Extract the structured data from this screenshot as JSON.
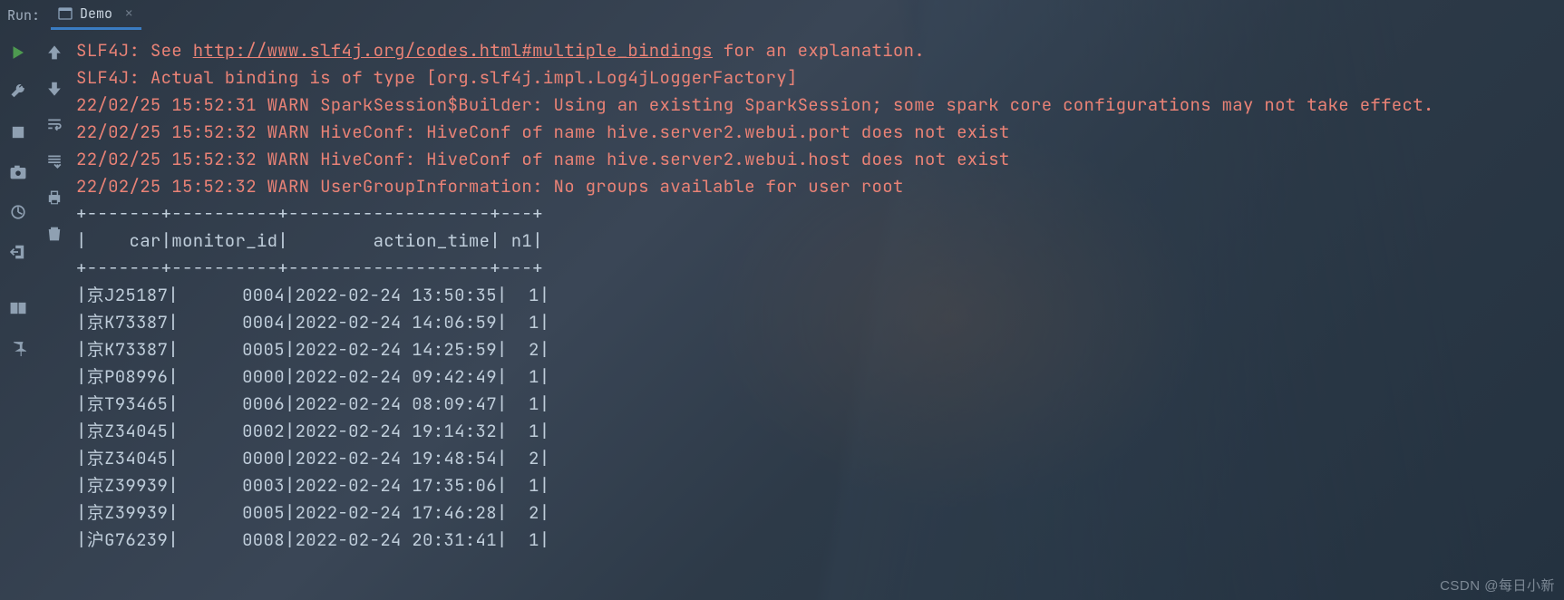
{
  "topbar": {
    "run_label": "Run:",
    "tab_name": "Demo"
  },
  "log": {
    "l1_prefix": "SLF4J: See ",
    "l1_link": "http://www.slf4j.org/codes.html#multiple_bindings",
    "l1_suffix": " for an explanation.",
    "l2": "SLF4J: Actual binding is of type [org.slf4j.impl.Log4jLoggerFactory]",
    "l3": "22/02/25 15:52:31 WARN SparkSession$Builder: Using an existing SparkSession; some spark core configurations may not take effect.",
    "l4": "22/02/25 15:52:32 WARN HiveConf: HiveConf of name hive.server2.webui.port does not exist",
    "l5": "22/02/25 15:52:32 WARN HiveConf: HiveConf of name hive.server2.webui.host does not exist",
    "l6": "22/02/25 15:52:32 WARN UserGroupInformation: No groups available for user root"
  },
  "table": {
    "border": "+-------+----------+-------------------+---+",
    "header": "|    car|monitor_id|        action_time| n1|",
    "rows": [
      "|京J25187|      0004|2022-02-24 13:50:35|  1|",
      "|京K73387|      0004|2022-02-24 14:06:59|  1|",
      "|京K73387|      0005|2022-02-24 14:25:59|  2|",
      "|京P08996|      0000|2022-02-24 09:42:49|  1|",
      "|京T93465|      0006|2022-02-24 08:09:47|  1|",
      "|京Z34045|      0002|2022-02-24 19:14:32|  1|",
      "|京Z34045|      0000|2022-02-24 19:48:54|  2|",
      "|京Z39939|      0003|2022-02-24 17:35:06|  1|",
      "|京Z39939|      0005|2022-02-24 17:46:28|  2|",
      "|沪G76239|      0008|2022-02-24 20:31:41|  1|"
    ]
  },
  "watermark": "CSDN @每日小新"
}
